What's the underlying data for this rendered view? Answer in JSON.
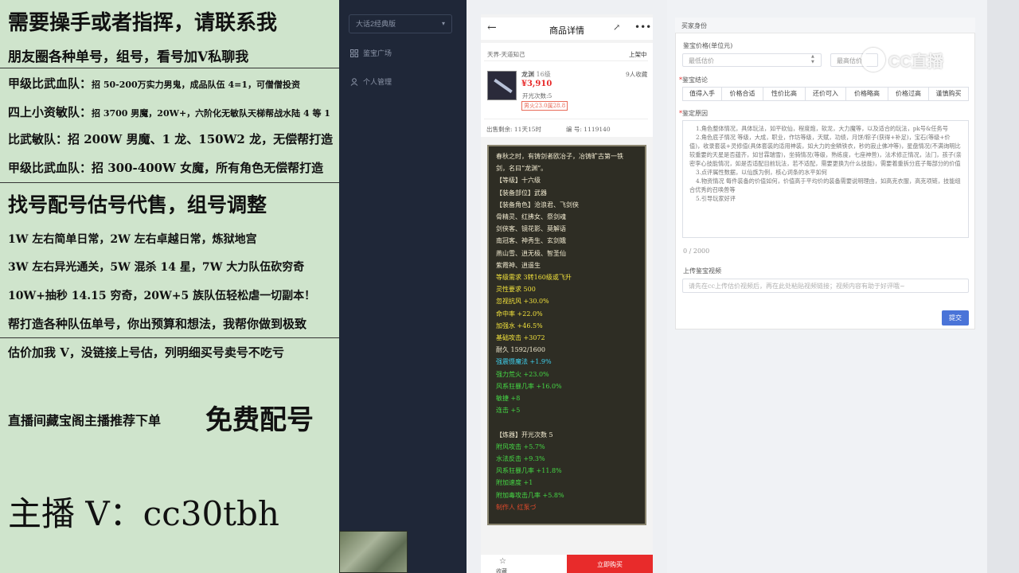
{
  "overlay": {
    "lines": [
      "需要操手或者指挥，请联系我",
      "朋友圈各种单号，组号，看号加V私聊我",
      "甲级比武血队：",
      "招 50-200万实力男鬼，成品队伍 4=1，可僧僧投资",
      "四上小资敏队：",
      "招 3700 男魔，20W+，六阶化无敏队天梯帮战水陆 4 等 1",
      "比武敏队：招 200W 男魔、1 龙、150W2 龙，无偿帮打造",
      "甲级比武血队：招 300-400W 女魔，所有角色无偿帮打造",
      "找号配号估号代售，组号调整",
      "1W 左右简单日常，2W 左右卓越日常，炼狱地宫",
      "3W 左右异光通关，5W 混杀 14 星，7W 大力队伍砍穷奇",
      "10W+抽秒 14.15 穷奇，20W+5 族队伍轻松虐一切副本！",
      "帮打造各种队伍单号，你出预算和想法，我帮你做到极致",
      "估价加我 V，没链接上号估，列明细买号卖号不吃亏",
      "直播间藏宝阁主播推荐下单",
      "免费配号",
      "主播 V：cc30tbh"
    ]
  },
  "sidebar": {
    "select_label": "大话2经典版",
    "items": [
      {
        "label": "鉴宝广场",
        "icon": "grid-icon"
      },
      {
        "label": "个人管理",
        "icon": "user-icon"
      }
    ]
  },
  "phone": {
    "title": "商品详情",
    "server": "天界-天道知己",
    "listing_status": "上架中",
    "item_name": "龙渊",
    "item_level": "16级",
    "price": "¥3,910",
    "favorites": "9人收藏",
    "open_count": "开光次数:5",
    "tag_text": "男火23.0属28.8",
    "remaining": "出售剩余: 11天15时",
    "serial": "编 号: 1119140",
    "fav_label": "收藏",
    "buy_label": "立即购买",
    "desc_lines": [
      {
        "text": "春秋之时，有铸剑者欧冶子，冶铸旷古第一铁",
        "color": "#f1ead0"
      },
      {
        "text": "剑，名曰“龙渊”。",
        "color": "#f1ead0"
      },
      {
        "text": "【等级】十六级",
        "color": "#f1ead0"
      },
      {
        "text": "【装备部位】武器",
        "color": "#f1ead0"
      },
      {
        "text": "【装备角色】沧浪君、飞剑侠",
        "color": "#f1ead0"
      },
      {
        "text": "骨精灵、红拂女、祭剑魂",
        "color": "#f1ead0"
      },
      {
        "text": "剑侠客、镜花影、莫解语",
        "color": "#f1ead0"
      },
      {
        "text": "南冠客、神秀生、玄剑娥",
        "color": "#f1ead0"
      },
      {
        "text": "燕山雪、逍无极、智圣仙",
        "color": "#f1ead0"
      },
      {
        "text": "紫霞神、逍遥生",
        "color": "#f1ead0"
      },
      {
        "text": "等级需求 3转160级或飞升",
        "color": "#f2e23c"
      },
      {
        "text": "灵性要求 500",
        "color": "#f2e23c"
      },
      {
        "text": "忽视抗风 +30.0%",
        "color": "#f2e23c"
      },
      {
        "text": "命中率 +22.0%",
        "color": "#f2e23c"
      },
      {
        "text": "加强水 +46.5%",
        "color": "#f2e23c"
      },
      {
        "text": "基础攻击 +3072",
        "color": "#f2e23c"
      },
      {
        "text": "耐久 1592/1600",
        "color": "#f1ead0"
      },
      {
        "text": "强震慑魔法 +1.9%",
        "color": "#3fd0ee"
      },
      {
        "text": "强力荒火 +23.0%",
        "color": "#45d845"
      },
      {
        "text": "风系狂暴几率 +16.0%",
        "color": "#45d845"
      },
      {
        "text": "敏捷 +8",
        "color": "#45d845"
      },
      {
        "text": "连击 +5",
        "color": "#45d845"
      },
      {
        "text": "",
        "color": "#f1ead0"
      },
      {
        "text": "【炼器】开光次数 5",
        "color": "#f1ead0"
      },
      {
        "text": "附风攻击 +5.7%",
        "color": "#45d845"
      },
      {
        "text": "水法反击 +9.3%",
        "color": "#45d845"
      },
      {
        "text": "风系狂暴几率 +11.8%",
        "color": "#45d845"
      },
      {
        "text": "附加速度 +1",
        "color": "#45d845"
      },
      {
        "text": "附加毒攻击几率 +5.8%",
        "color": "#45d845"
      },
      {
        "text": "制作人 红泵づ",
        "color": "#e34a2c"
      }
    ]
  },
  "form": {
    "section_title": "买家身份",
    "price_label": "鉴宝价格(单位元)",
    "min_placeholder": "最低估价",
    "max_placeholder": "最高估价",
    "conclusion_label": "鉴宝结论",
    "tags": [
      "值得入手",
      "价格合适",
      "性价比高",
      "还价可入",
      "价格略高",
      "价格过高",
      "谨慎购买"
    ],
    "reason_label": "鉴定原因",
    "reason_text": "1.角色整体情况，具体玩法，如平砍仙，程度炮，软龙，大力魔等，以及适合的玩法，pk号&任务号\n2.角色底子情况 等级，大成，职业，作坊等级，天赋，功绩，月饼/粽子(获得+补足)，宝石(等级+价值)，收录套装+灵修值(具体套装的适用神装，如大力的金鳞铁衣，秒的寂止佛冲等)，星盘情况(不满询明比较重要的天星是否蕴齐，如甘霖瑞雪)，坐骑情况(等级，熟练度，七座神兽)，法术修正情况，法门，孩子(亲密李心技能情况，如是否适配目前玩法，若不适配，需要更换为什么技能)，需要着重拆分底子每部分的价值\n3.点评属性数据，以仙族为例，核心词条的水平如何\n4.物资情况 每件装备的价值如何，价值高于平均价的装备需要说明理由，如高克衣服，高克项链，技能组合优秀的召唤兽等\n5.引导玩家好评",
    "counter": "0 / 2000",
    "video_label": "上传鉴宝视频",
    "video_placeholder": "请先在cc上传估价视频后，再在此处粘贴视频链接；视频内容有助于好评哦~",
    "submit_label": "提交"
  },
  "watermark": {
    "text": "CC直播"
  },
  "colors": {
    "sidebar": "#1f2738",
    "accent": "#4a74d8",
    "buy": "#e82b2b",
    "price": "#e82b2b"
  }
}
